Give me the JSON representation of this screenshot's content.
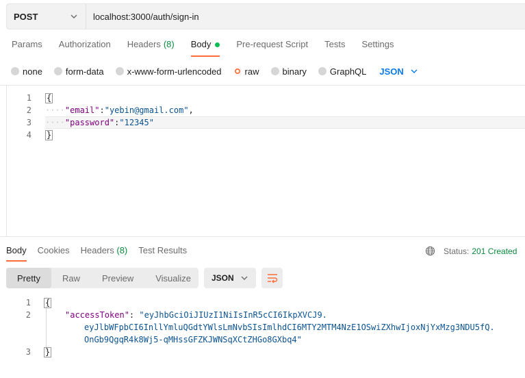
{
  "request": {
    "method": "POST",
    "url": "localhost:3000/auth/sign-in"
  },
  "request_tabs": [
    {
      "label": "Params"
    },
    {
      "label": "Authorization"
    },
    {
      "label": "Headers",
      "count": "(8)"
    },
    {
      "label": "Body"
    },
    {
      "label": "Pre-request Script"
    },
    {
      "label": "Tests"
    },
    {
      "label": "Settings"
    }
  ],
  "body_types": [
    "none",
    "form-data",
    "x-www-form-urlencoded",
    "raw",
    "binary",
    "GraphQL"
  ],
  "body_format": "JSON",
  "request_body": {
    "line_numbers": [
      "1",
      "2",
      "3",
      "4"
    ],
    "open_brace": "{",
    "close_brace": "}",
    "email_key": "\"email\"",
    "email_value": "\"yebin@gmail.com\"",
    "password_key": "\"password\"",
    "password_value": "\"12345\"",
    "indent": "····"
  },
  "response_tabs": [
    {
      "label": "Body"
    },
    {
      "label": "Cookies"
    },
    {
      "label": "Headers",
      "count": "(8)"
    },
    {
      "label": "Test Results"
    }
  ],
  "status": {
    "label": "Status:",
    "value": "201 Created"
  },
  "view_tabs": [
    "Pretty",
    "Raw",
    "Preview",
    "Visualize"
  ],
  "response_format": "JSON",
  "response_body": {
    "line_numbers": [
      "1",
      "2",
      "3"
    ],
    "open_brace": "{",
    "close_brace": "}",
    "key": "\"accessToken\"",
    "token_line1": "\"eyJhbGciOiJIUzI1NiIsInR5cCI6IkpXVCJ9.",
    "token_line2": "eyJlbWFpbCI6InllYmluQGdtYWlsLmNvbSIsImlhdCI6MTY2MTM4NzE1OSwiZXhwIjoxNjYxMzg3NDU5fQ.",
    "token_line3": "OnGb9QgqR4k8Wj5-qMHssGFZKJWNSqXCtZHGo8GXbq4\""
  },
  "colors": {
    "accent": "#ff6c37",
    "link": "#097bed",
    "success": "#0cbb52"
  }
}
